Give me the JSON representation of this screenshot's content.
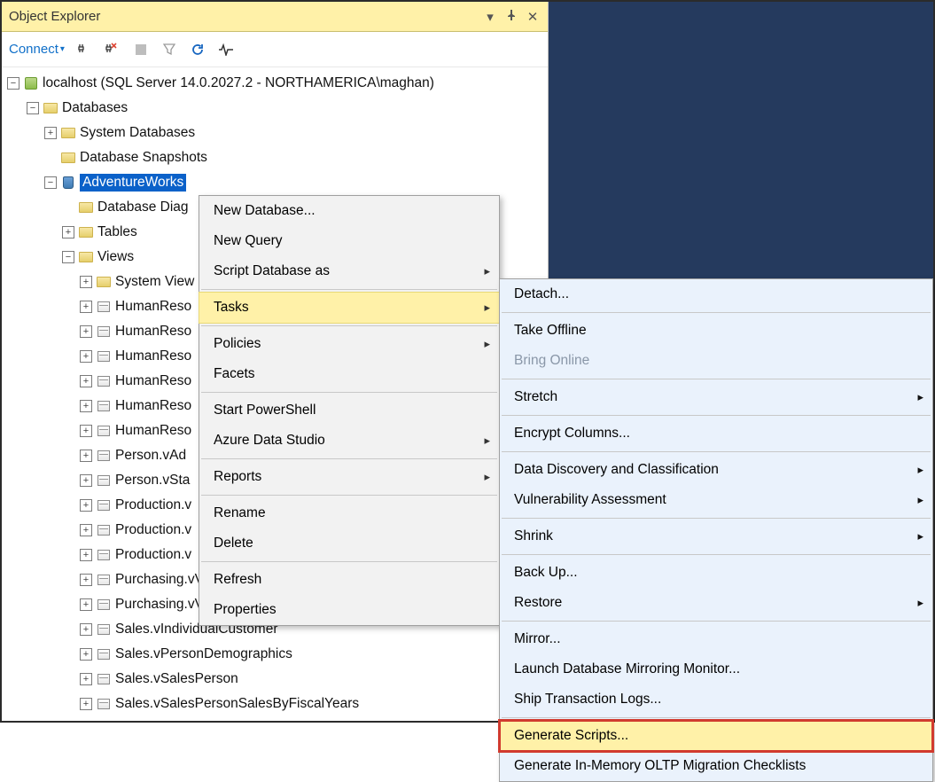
{
  "panel": {
    "title": "Object Explorer"
  },
  "toolbar": {
    "connect": "Connect"
  },
  "tree": {
    "server": "localhost (SQL Server 14.0.2027.2 - NORTHAMERICA\\maghan)",
    "databases": "Databases",
    "sysdb": "System Databases",
    "snapshots": "Database Snapshots",
    "selected_db": "AdventureWorks",
    "diagrams": "Database Diag",
    "tables": "Tables",
    "views_lbl": "Views",
    "sysviews": "System View",
    "views": [
      "HumanReso",
      "HumanReso",
      "HumanReso",
      "HumanReso",
      "HumanReso",
      "HumanReso",
      "Person.vAd",
      "Person.vSta",
      "Production.v",
      "Production.v",
      "Production.v",
      "Purchasing.vVendorWithAddresses",
      "Purchasing.vVendorWithContacts",
      "Sales.vIndividualCustomer",
      "Sales.vPersonDemographics",
      "Sales.vSalesPerson",
      "Sales.vSalesPersonSalesByFiscalYears"
    ]
  },
  "ctx": {
    "newdb": "New Database...",
    "newq": "New Query",
    "scriptdb": "Script Database as",
    "tasks": "Tasks",
    "policies": "Policies",
    "facets": "Facets",
    "startps": "Start PowerShell",
    "ads": "Azure Data Studio",
    "reports": "Reports",
    "rename": "Rename",
    "delete": "Delete",
    "refresh": "Refresh",
    "props": "Properties"
  },
  "tasks": {
    "detach": "Detach...",
    "offline": "Take Offline",
    "online": "Bring Online",
    "stretch": "Stretch",
    "encrypt": "Encrypt Columns...",
    "ddc": "Data Discovery and Classification",
    "vuln": "Vulnerability Assessment",
    "shrink": "Shrink",
    "backup": "Back Up...",
    "restore": "Restore",
    "mirror": "Mirror...",
    "monitor": "Launch Database Mirroring Monitor...",
    "ship": "Ship Transaction Logs...",
    "genscripts": "Generate Scripts...",
    "geninmem": "Generate In-Memory OLTP Migration Checklists"
  }
}
